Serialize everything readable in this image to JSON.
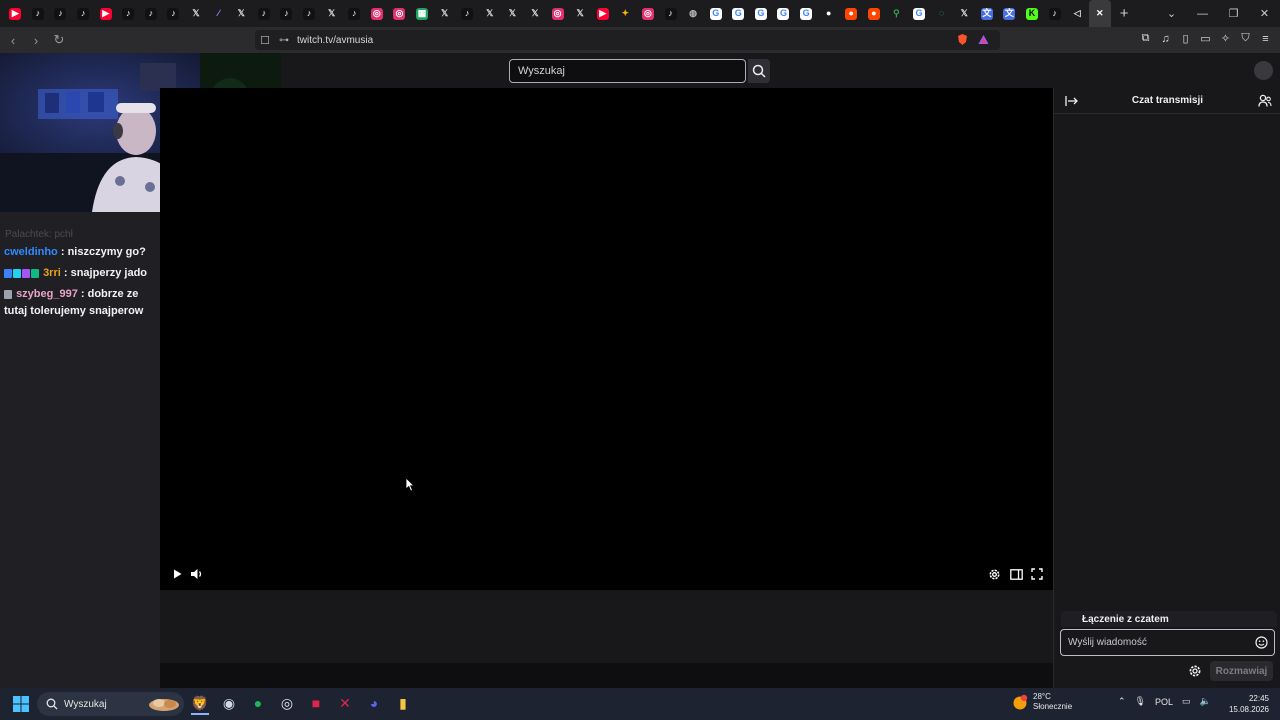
{
  "browser": {
    "tabs": [
      {
        "icon": "youtube-icon",
        "glyph": "▶",
        "bg": "#ff0033",
        "fg": "#fff"
      },
      {
        "icon": "tiktok-icon",
        "glyph": "♪",
        "bg": "#111",
        "fg": "#fff"
      },
      {
        "icon": "tiktok-icon",
        "glyph": "♪",
        "bg": "#111",
        "fg": "#fff"
      },
      {
        "icon": "tiktok-icon",
        "glyph": "♪",
        "bg": "#111",
        "fg": "#fff"
      },
      {
        "icon": "youtube-icon",
        "glyph": "▶",
        "bg": "#ff0033",
        "fg": "#fff"
      },
      {
        "icon": "tiktok-icon",
        "glyph": "♪",
        "bg": "#111",
        "fg": "#fff"
      },
      {
        "icon": "tiktok-icon",
        "glyph": "♪",
        "bg": "#111",
        "fg": "#fff"
      },
      {
        "icon": "tiktok-icon",
        "glyph": "♪",
        "bg": "#111",
        "fg": "#fff"
      },
      {
        "icon": "x-icon",
        "glyph": "𝕏",
        "bg": "transparent",
        "fg": "#ddd"
      },
      {
        "icon": "feather-icon",
        "glyph": "∕",
        "bg": "transparent",
        "fg": "#b57bff"
      },
      {
        "icon": "x-icon",
        "glyph": "𝕏",
        "bg": "transparent",
        "fg": "#ddd"
      },
      {
        "icon": "tiktok-icon",
        "glyph": "♪",
        "bg": "#111",
        "fg": "#fff"
      },
      {
        "icon": "tiktok-icon",
        "glyph": "♪",
        "bg": "#111",
        "fg": "#fff"
      },
      {
        "icon": "tiktok-icon",
        "glyph": "♪",
        "bg": "#111",
        "fg": "#fff"
      },
      {
        "icon": "x-icon",
        "glyph": "𝕏",
        "bg": "transparent",
        "fg": "#ddd"
      },
      {
        "icon": "tiktok-icon",
        "glyph": "♪",
        "bg": "#111",
        "fg": "#fff"
      },
      {
        "icon": "instagram-icon",
        "glyph": "◎",
        "bg": "#e1306c",
        "fg": "#fff"
      },
      {
        "icon": "instagram-icon",
        "glyph": "◎",
        "bg": "#e1306c",
        "fg": "#fff"
      },
      {
        "icon": "sheets-icon",
        "glyph": "▦",
        "bg": "#1fa463",
        "fg": "#fff"
      },
      {
        "icon": "x-icon",
        "glyph": "𝕏",
        "bg": "transparent",
        "fg": "#ddd"
      },
      {
        "icon": "tiktok-icon",
        "glyph": "♪",
        "bg": "#111",
        "fg": "#fff"
      },
      {
        "icon": "x-icon",
        "glyph": "𝕏",
        "bg": "transparent",
        "fg": "#ddd"
      },
      {
        "icon": "x-icon",
        "glyph": "𝕏",
        "bg": "transparent",
        "fg": "#ddd"
      },
      {
        "icon": "x-icon",
        "glyph": "𝕏",
        "bg": "transparent",
        "fg": "#ddd"
      },
      {
        "icon": "instagram-icon",
        "glyph": "◎",
        "bg": "#e1306c",
        "fg": "#fff"
      },
      {
        "icon": "x-icon",
        "glyph": "𝕏",
        "bg": "transparent",
        "fg": "#ddd"
      },
      {
        "icon": "youtube-icon",
        "glyph": "▶",
        "bg": "#ff0033",
        "fg": "#fff"
      },
      {
        "icon": "pinwheel-icon",
        "glyph": "✦",
        "bg": "transparent",
        "fg": "#f4b400"
      },
      {
        "icon": "instagram-icon",
        "glyph": "◎",
        "bg": "#e1306c",
        "fg": "#fff"
      },
      {
        "icon": "tiktok-icon",
        "glyph": "♪",
        "bg": "#111",
        "fg": "#fff"
      },
      {
        "icon": "globe-icon",
        "glyph": "◍",
        "bg": "transparent",
        "fg": "#bbb"
      },
      {
        "icon": "google-icon",
        "glyph": "G",
        "bg": "#fff",
        "fg": "#4285f4"
      },
      {
        "icon": "google-icon",
        "glyph": "G",
        "bg": "#fff",
        "fg": "#4285f4"
      },
      {
        "icon": "google-icon",
        "glyph": "G",
        "bg": "#fff",
        "fg": "#4285f4"
      },
      {
        "icon": "google-icon",
        "glyph": "G",
        "bg": "#fff",
        "fg": "#4285f4"
      },
      {
        "icon": "google-icon",
        "glyph": "G",
        "bg": "#fff",
        "fg": "#4285f4"
      },
      {
        "icon": "circle-icon",
        "glyph": "●",
        "bg": "transparent",
        "fg": "#fff"
      },
      {
        "icon": "reddit-icon",
        "glyph": "●",
        "bg": "#ff4500",
        "fg": "#fff"
      },
      {
        "icon": "reddit-icon",
        "glyph": "●",
        "bg": "#ff4500",
        "fg": "#fff"
      },
      {
        "icon": "maps-icon",
        "glyph": "⚲",
        "bg": "transparent",
        "fg": "#34a853"
      },
      {
        "icon": "google-icon",
        "glyph": "G",
        "bg": "#fff",
        "fg": "#4285f4"
      },
      {
        "icon": "loading-icon",
        "glyph": "◌",
        "bg": "transparent",
        "fg": "#2ad1a0"
      },
      {
        "icon": "x-icon",
        "glyph": "𝕏",
        "bg": "transparent",
        "fg": "#ddd"
      },
      {
        "icon": "translate-icon",
        "glyph": "文",
        "bg": "#4a6fe3",
        "fg": "#fff"
      },
      {
        "icon": "translate-icon",
        "glyph": "文",
        "bg": "#4a6fe3",
        "fg": "#fff"
      },
      {
        "icon": "kick-icon",
        "glyph": "K",
        "bg": "#53fc18",
        "fg": "#000"
      },
      {
        "icon": "tiktok-icon",
        "glyph": "♪",
        "bg": "#111",
        "fg": "#fff"
      },
      {
        "icon": "audio-icon",
        "glyph": "◁",
        "bg": "transparent",
        "fg": "#ddd"
      },
      {
        "icon": "close-tab-icon",
        "glyph": "✕",
        "bg": "transparent",
        "fg": "#fff",
        "active": true
      }
    ],
    "new_tab": "+",
    "url": "twitch.tv/avmusia"
  },
  "twitch": {
    "search_placeholder": "Wyszukaj"
  },
  "left_chat": {
    "faded": "Palachtek: pchł",
    "messages": [
      {
        "user": "cweldinho",
        "color": "#2e8bff",
        "text": ": niszczymy go?",
        "badges": []
      },
      {
        "user": "3rri",
        "color": "#e8a11c",
        "text": ": snajperzy jado",
        "badges": [
          "#3b82f6",
          "#22d3ee",
          "#a855f7",
          "#10b981"
        ]
      },
      {
        "user": "szybeg_997",
        "color": "#e9a3c8",
        "text": ": dobrze ze tutaj tolerujemy snajperow",
        "badges": [
          "#9ca3af"
        ]
      }
    ]
  },
  "chat": {
    "title": "Czat transmisji",
    "connecting": "Łączenie z czatem",
    "placeholder": "Wyślij wiadomość",
    "send": "Rozmawiaj"
  },
  "taskbar": {
    "search": "Wyszukaj",
    "apps": [
      {
        "icon": "brave-icon",
        "glyph": "🦁",
        "color": "#fb542b",
        "active": true
      },
      {
        "icon": "obs-icon",
        "glyph": "◉",
        "color": "#cfd8e8",
        "active": false
      },
      {
        "icon": "spotify-icon",
        "glyph": "●",
        "color": "#1db954",
        "active": false
      },
      {
        "icon": "chrome-icon",
        "glyph": "◎",
        "color": "#e5e7eb",
        "active": false
      },
      {
        "icon": "app-red-icon",
        "glyph": "■",
        "color": "#e0244a",
        "active": false
      },
      {
        "icon": "app-x-icon",
        "glyph": "✕",
        "color": "#e0244a",
        "active": false
      },
      {
        "icon": "discord-icon",
        "glyph": "◕",
        "color": "#5865f2",
        "active": false
      },
      {
        "icon": "folder-icon",
        "glyph": "▮",
        "color": "#f5c542",
        "active": false
      }
    ],
    "weather_temp": "28°C",
    "weather_desc": "Słonecznie",
    "lang": "POL",
    "time": "22:45",
    "date": "15.08.2026"
  }
}
